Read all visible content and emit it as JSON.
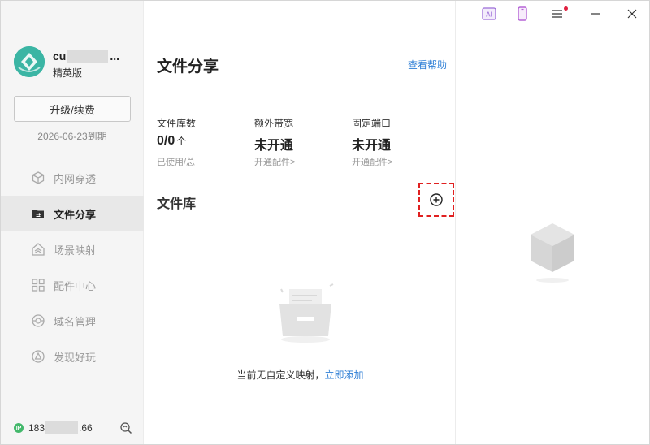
{
  "sidebar": {
    "user_name_prefix": "cu",
    "user_name_suffix": "...",
    "plan": "精英版",
    "upgrade_label": "升级/续费",
    "expire_text": "2026-06-23到期",
    "items": [
      {
        "label": "内网穿透",
        "icon": "cube-outline-icon"
      },
      {
        "label": "文件分享",
        "icon": "folder-share-icon"
      },
      {
        "label": "场景映射",
        "icon": "house-layers-icon"
      },
      {
        "label": "配件中心",
        "icon": "grid-icon"
      },
      {
        "label": "域名管理",
        "icon": "globe-icon"
      },
      {
        "label": "发现好玩",
        "icon": "triangle-circle-icon"
      }
    ],
    "active_index": 1,
    "ip_prefix": "183",
    "ip_suffix": ".66"
  },
  "main": {
    "title": "文件分享",
    "help_link": "查看帮助",
    "stats": [
      {
        "label": "文件库数",
        "value": "0/0",
        "unit": "个",
        "sub": "已使用/总"
      },
      {
        "label": "额外带宽",
        "value": "未开通",
        "unit": "",
        "sub": "开通配件>"
      },
      {
        "label": "固定端口",
        "value": "未开通",
        "unit": "",
        "sub": "开通配件>"
      }
    ],
    "library_title": "文件库",
    "empty_text": "当前无自定义映射，",
    "empty_link": "立即添加"
  },
  "colors": {
    "accent_link": "#2f7fd6",
    "logo": "#3bb5a4",
    "highlight_dashed": "#e02020",
    "ip_badge": "#43b86b"
  }
}
